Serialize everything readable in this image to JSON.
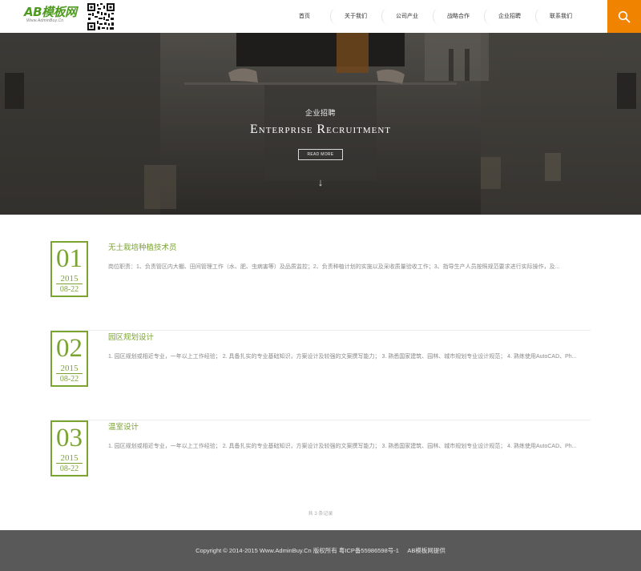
{
  "brand": {
    "logo_text": "AB模板网",
    "logo_subtext": "Www.AdminBuy.Cn"
  },
  "nav": {
    "items": [
      {
        "label": "首页"
      },
      {
        "label": "关于我们"
      },
      {
        "label": "公司产业"
      },
      {
        "label": "战略合作"
      },
      {
        "label": "企业招聘"
      },
      {
        "label": "联系我们"
      }
    ]
  },
  "search": {
    "icon": "search-icon"
  },
  "banner": {
    "title": "企业招聘",
    "subtitle": "Enterprise Recruitment",
    "button_label": "READ MORE",
    "arrow": "↓"
  },
  "jobs": [
    {
      "num": "01",
      "year": "2015",
      "md": "08-22",
      "title": "无土栽培种植技术员",
      "desc": "岗位职责：1、负责管区内大棚、田间管理工作（水、肥、虫病害等）及品质监控；2、负责种植计划的实施以及采收质量验收工作；3、指导生产人员按照规范要求进行实际操作，及..."
    },
    {
      "num": "02",
      "year": "2015",
      "md": "08-22",
      "title": "园区规划设计",
      "desc": "1. 园区规划或相近专业，一年以上工作经验； 2. 具备扎实的专业基础知识，方案设计及较强的文案撰写能力； 3. 熟悉国家建筑、园林、城市规划专业设计规范； 4. 熟练使用AutoCAD、Ph..."
    },
    {
      "num": "03",
      "year": "2015",
      "md": "08-22",
      "title": "温室设计",
      "desc": "1. 园区规划或相近专业，一年以上工作经验； 2. 具备扎实的专业基础知识，方案设计及较强的文案撰写能力； 3. 熟悉国家建筑、园林、城市规划专业设计规范； 4. 熟练使用AutoCAD、Ph..."
    }
  ],
  "pager": {
    "text": "共 3 条记录"
  },
  "footer": {
    "copyright": "Copyright © 2014-2015 Www.AdminBuy.Cn 版权所有 粤ICP备55986598号-1",
    "credit": "AB模板网提供"
  },
  "colors": {
    "accent_green": "#7aa332",
    "search_orange": "#f08300",
    "footer_bg": "#595959"
  }
}
